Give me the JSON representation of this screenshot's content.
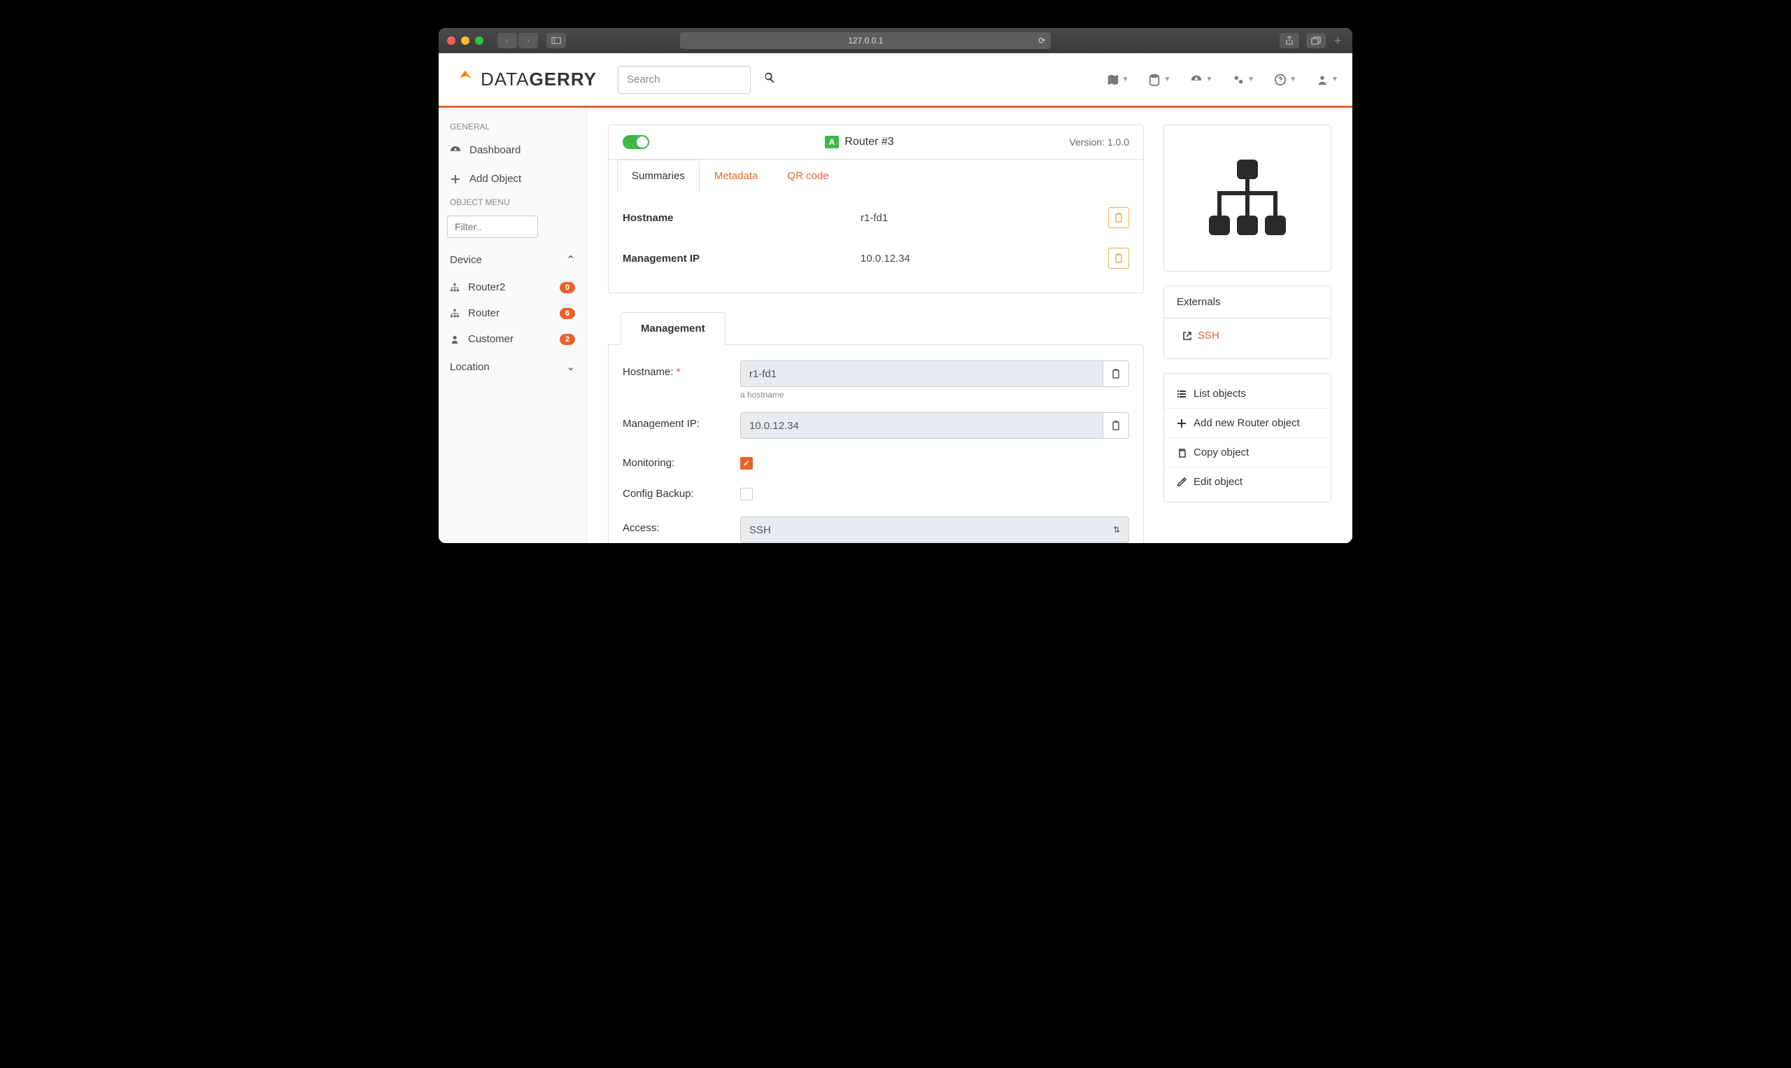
{
  "browser": {
    "url": "127.0.0.1"
  },
  "search": {
    "placeholder": "Search"
  },
  "sidebar": {
    "section_general": "GENERAL",
    "dashboard": "Dashboard",
    "add_object": "Add Object",
    "section_object": "OBJECT MENU",
    "filter_placeholder": "Filter..",
    "device_group": "Device",
    "items": [
      {
        "label": "Router2",
        "count": "0"
      },
      {
        "label": "Router",
        "count": "6"
      },
      {
        "label": "Customer",
        "count": "2"
      }
    ],
    "location_group": "Location"
  },
  "object": {
    "active_badge": "A",
    "title": "Router #3",
    "version": "Version: 1.0.0",
    "tabs": {
      "summaries": "Summaries",
      "metadata": "Metadata",
      "qr": "QR code"
    },
    "summary": {
      "hostname_label": "Hostname",
      "hostname_value": "r1-fd1",
      "mgmtip_label": "Management IP",
      "mgmtip_value": "10.0.12.34"
    }
  },
  "management": {
    "tab": "Management",
    "hostname_label": "Hostname:",
    "hostname_value": "r1-fd1",
    "hostname_help": "a hostname",
    "mgmtip_label": "Management IP:",
    "mgmtip_value": "10.0.12.34",
    "monitoring_label": "Monitoring:",
    "config_backup_label": "Config Backup:",
    "access_label": "Access:",
    "access_value": "SSH"
  },
  "externals": {
    "title": "Externals",
    "ssh": "SSH"
  },
  "actions": {
    "list": "List objects",
    "add": "Add new Router object",
    "copy": "Copy object",
    "edit": "Edit object"
  }
}
